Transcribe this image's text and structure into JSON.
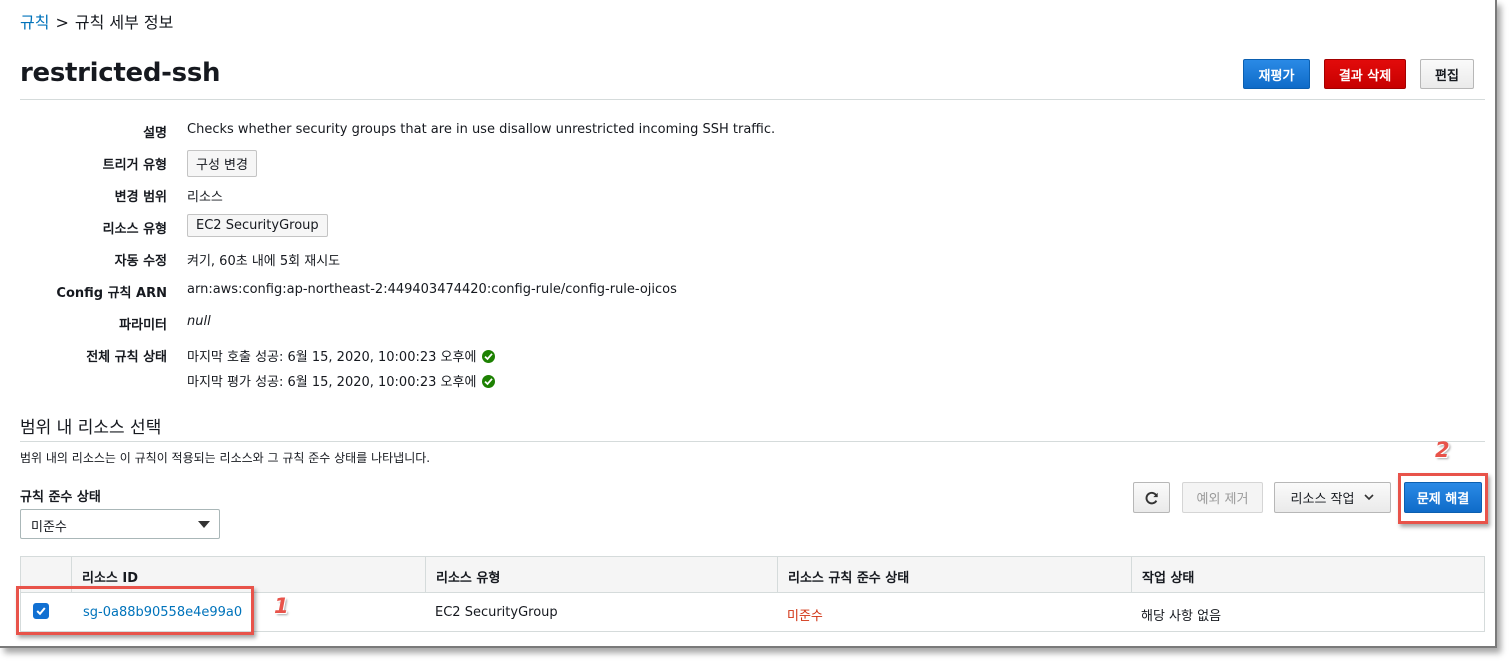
{
  "breadcrumb": {
    "parent": "규칙",
    "separator": ">",
    "current": "규칙 세부 정보"
  },
  "page": {
    "title": "restricted-ssh"
  },
  "actions": {
    "reevaluate": "재평가",
    "delete_results": "결과 삭제",
    "edit": "편집"
  },
  "details": {
    "description_label": "설명",
    "description_value": "Checks whether security groups that are in use disallow unrestricted incoming SSH traffic.",
    "trigger_label": "트리거 유형",
    "trigger_value": "구성 변경",
    "scope_label": "변경 범위",
    "scope_value": "리소스",
    "resource_type_label": "리소스 유형",
    "resource_type_value": "EC2 SecurityGroup",
    "remediation_label": "자동 수정",
    "remediation_value": "켜기, 60초 내에 5회 재시도",
    "arn_label": "Config 규칙 ARN",
    "arn_value": "arn:aws:config:ap-northeast-2:449403474420:config-rule/config-rule-ojicos",
    "params_label": "파라미터",
    "params_value": "null",
    "status_label": "전체 규칙 상태",
    "status_invoke": "마지막 호출 성공: 6월 15, 2020, 10:00:23 오후에",
    "status_eval": "마지막 평가 성공: 6월 15, 2020, 10:00:23 오후에"
  },
  "resources": {
    "title": "범위 내 리소스 선택",
    "description": "범위 내의 리소스는 이 규칙이 적용되는 리소스와 그 규칙 준수 상태를 나타냅니다.",
    "filter_label": "규칙 준수 상태",
    "filter_value": "미준수",
    "buttons": {
      "remove_exception": "예외 제거",
      "resource_actions": "리소스 작업",
      "remediate": "문제 해결"
    },
    "columns": [
      "리소스 ID",
      "리소스 유형",
      "리소스 규칙 준수 상태",
      "작업 상태"
    ],
    "rows": [
      {
        "id": "sg-0a88b90558e4e99a0",
        "type": "EC2 SecurityGroup",
        "compliance": "미준수",
        "action_status": "해당 사항 없음",
        "selected": true
      }
    ]
  },
  "annotations": {
    "step1": "1",
    "step2": "2"
  },
  "colors": {
    "link": "#0073bb",
    "primary": "#1170d2",
    "danger": "#d70000",
    "noncompliant": "#d13212",
    "success": "#1d8102",
    "annotation": "#e8534a"
  }
}
